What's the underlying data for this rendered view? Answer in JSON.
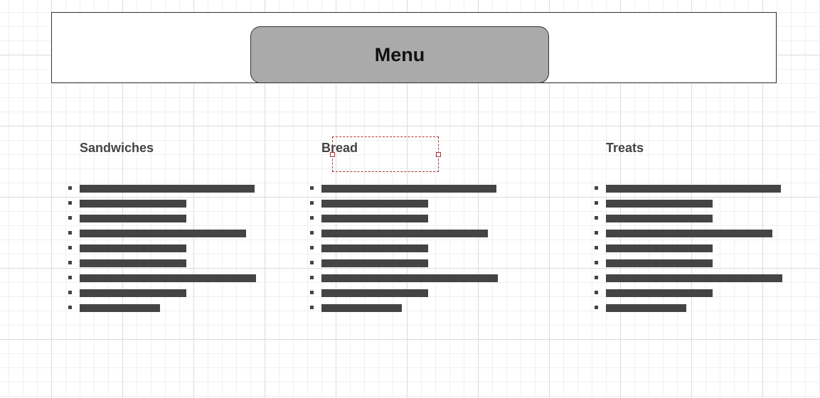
{
  "header": {
    "title": "Menu"
  },
  "columns": [
    {
      "heading": "Sandwiches",
      "item_lengths": [
        1.0,
        0.61,
        0.61,
        0.95,
        0.61,
        0.61,
        1.01,
        0.61,
        0.46
      ]
    },
    {
      "heading": "Bread",
      "item_lengths": [
        1.0,
        0.61,
        0.61,
        0.95,
        0.61,
        0.61,
        1.01,
        0.61,
        0.46
      ]
    },
    {
      "heading": "Treats",
      "item_lengths": [
        1.0,
        0.61,
        0.61,
        0.95,
        0.61,
        0.61,
        1.01,
        0.61,
        0.46
      ]
    }
  ],
  "selection": {
    "selected": "Bread"
  },
  "colors": {
    "title_fill": "#aaaaaa",
    "text_dark": "#444444",
    "selection_outline": "#b03030",
    "grid_major": "#dcdcdc",
    "grid_minor": "#f0f0f0"
  }
}
